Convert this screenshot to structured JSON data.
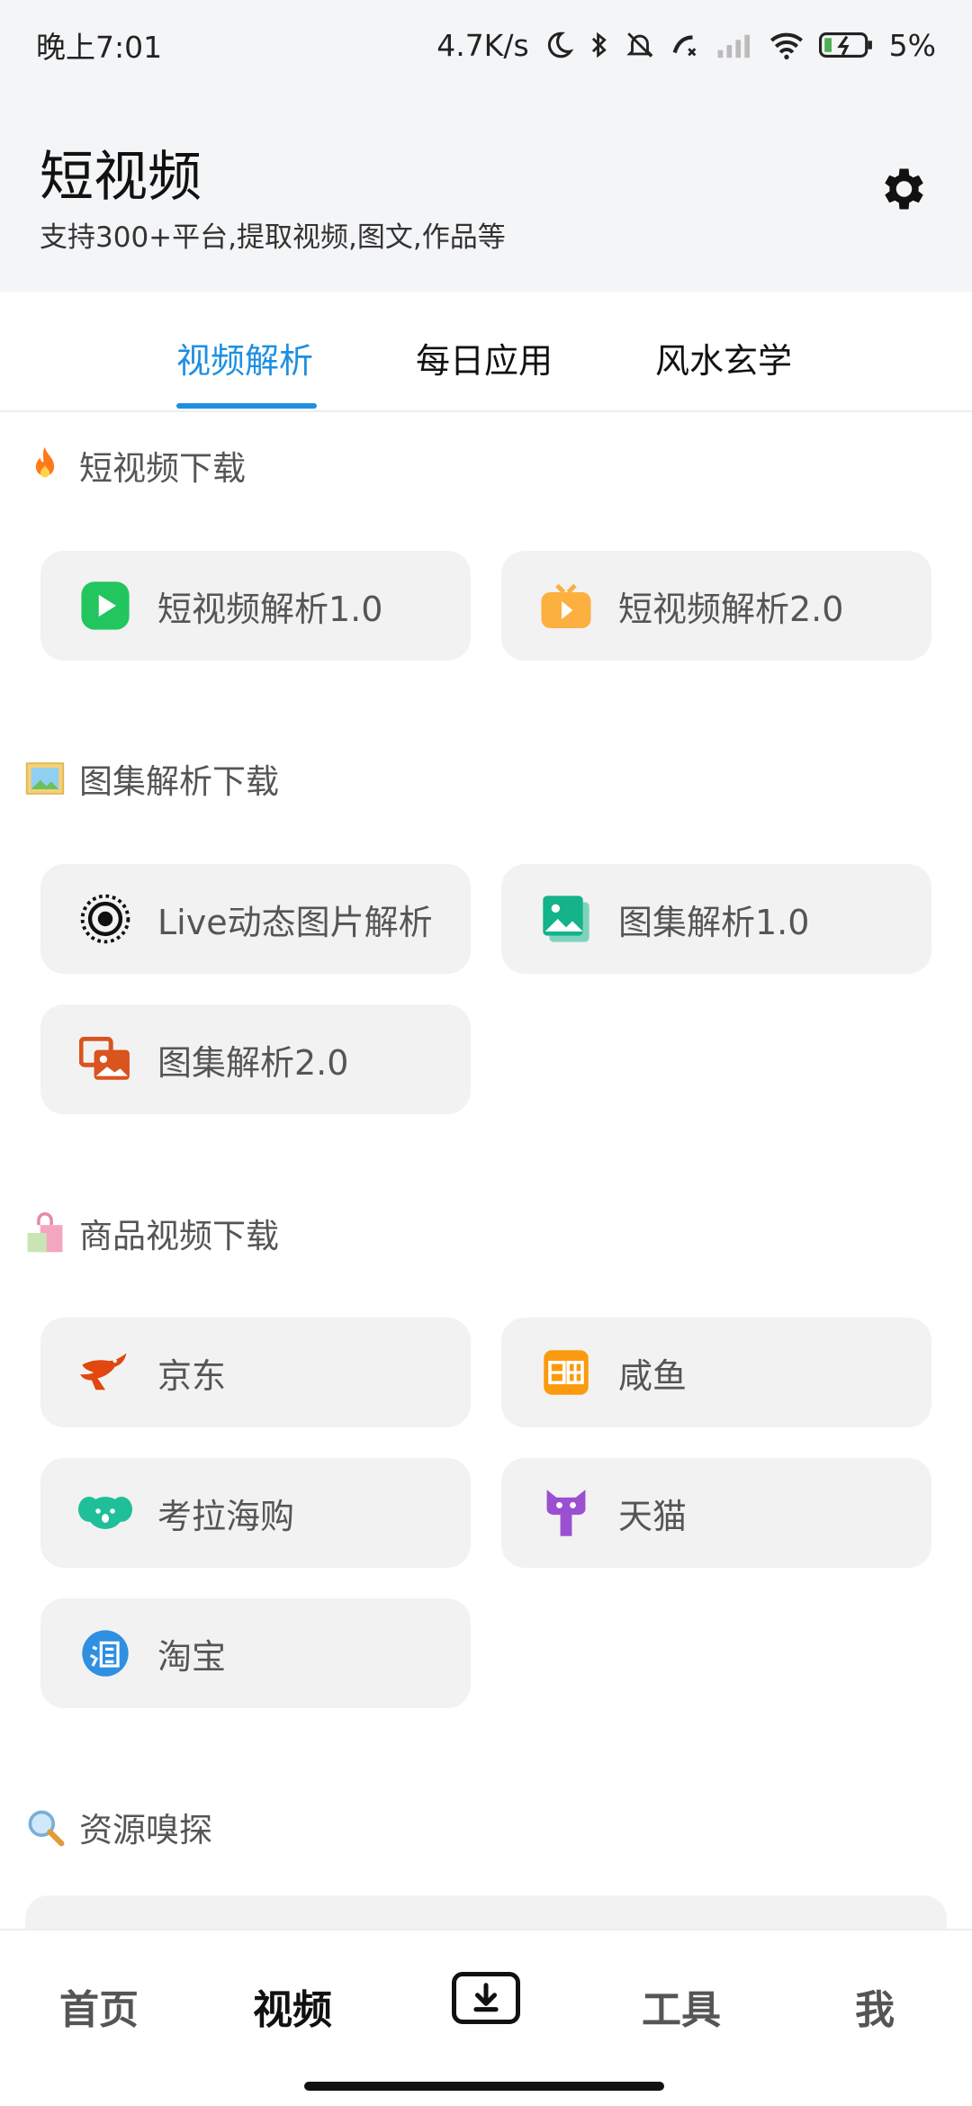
{
  "status_bar": {
    "time": "晚上7:01",
    "speed": "4.7K/s",
    "battery": "5%"
  },
  "header": {
    "title": "短视频",
    "subtitle": "支持300+平台,提取视频,图文,作品等",
    "settings_icon": "gear-icon"
  },
  "tabs": [
    {
      "label": "视频解析",
      "active": true
    },
    {
      "label": "每日应用",
      "active": false
    },
    {
      "label": "风水玄学",
      "active": false
    }
  ],
  "sections": [
    {
      "title": "短视频下载",
      "icon": "fire-icon",
      "items": [
        {
          "label": "短视频解析1.0",
          "icon": "play-green-icon"
        },
        {
          "label": "短视频解析2.0",
          "icon": "tv-play-orange-icon"
        }
      ]
    },
    {
      "title": "图集解析下载",
      "icon": "framed-picture-icon",
      "items": [
        {
          "label": "Live动态图片解析",
          "icon": "live-photo-icon"
        },
        {
          "label": "图集解析1.0",
          "icon": "gallery-teal-icon"
        },
        {
          "label": "图集解析2.0",
          "icon": "gallery-orange-icon"
        }
      ]
    },
    {
      "title": "商品视频下载",
      "icon": "shopping-bag-icon",
      "items": [
        {
          "label": "京东",
          "icon": "jd-icon"
        },
        {
          "label": "咸鱼",
          "icon": "xianyu-icon"
        },
        {
          "label": "考拉海购",
          "icon": "kaola-icon"
        },
        {
          "label": "天猫",
          "icon": "tmall-icon"
        },
        {
          "label": "淘宝",
          "icon": "taobao-icon"
        }
      ]
    },
    {
      "title": "资源嗅探",
      "icon": "magnifier-icon",
      "items": []
    }
  ],
  "bottom_nav": [
    {
      "label": "首页",
      "active": false
    },
    {
      "label": "视频",
      "active": true
    },
    {
      "label": "",
      "icon": "download-icon"
    },
    {
      "label": "工具",
      "active": false
    },
    {
      "label": "我",
      "active": false
    }
  ],
  "colors": {
    "accent": "#1f8fe0",
    "card_bg": "#f2f2f2",
    "header_bg": "#f4f5f7"
  }
}
